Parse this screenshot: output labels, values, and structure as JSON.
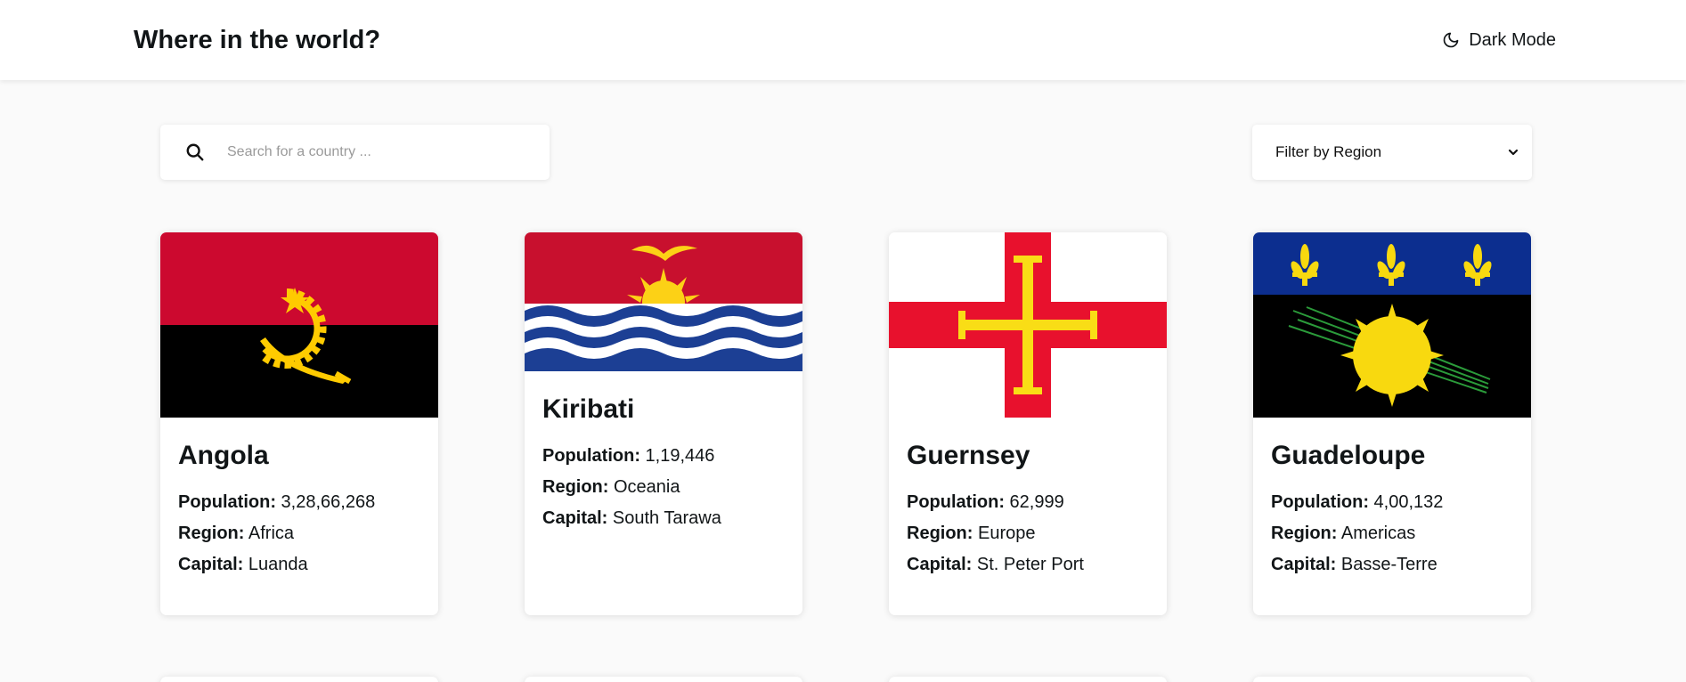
{
  "header": {
    "title": "Where in the world?",
    "theme_toggle_label": "Dark Mode"
  },
  "search": {
    "placeholder": "Search for a country ..."
  },
  "filter": {
    "selected": "Filter by Region"
  },
  "labels": {
    "population": "Population:",
    "region": "Region:",
    "capital": "Capital:"
  },
  "countries": [
    {
      "name": "Angola",
      "population": "3,28,66,268",
      "region": "Africa",
      "capital": "Luanda",
      "flag_icon": "angola-flag"
    },
    {
      "name": "Kiribati",
      "population": "1,19,446",
      "region": "Oceania",
      "capital": "South Tarawa",
      "flag_icon": "kiribati-flag"
    },
    {
      "name": "Guernsey",
      "population": "62,999",
      "region": "Europe",
      "capital": "St. Peter Port",
      "flag_icon": "guernsey-flag"
    },
    {
      "name": "Guadeloupe",
      "population": "4,00,132",
      "region": "Americas",
      "capital": "Basse-Terre",
      "flag_icon": "guadeloupe-flag"
    }
  ],
  "colors": {
    "background": "#fafafa",
    "surface": "#ffffff",
    "text": "#111517",
    "placeholder": "#9a9a9a"
  }
}
